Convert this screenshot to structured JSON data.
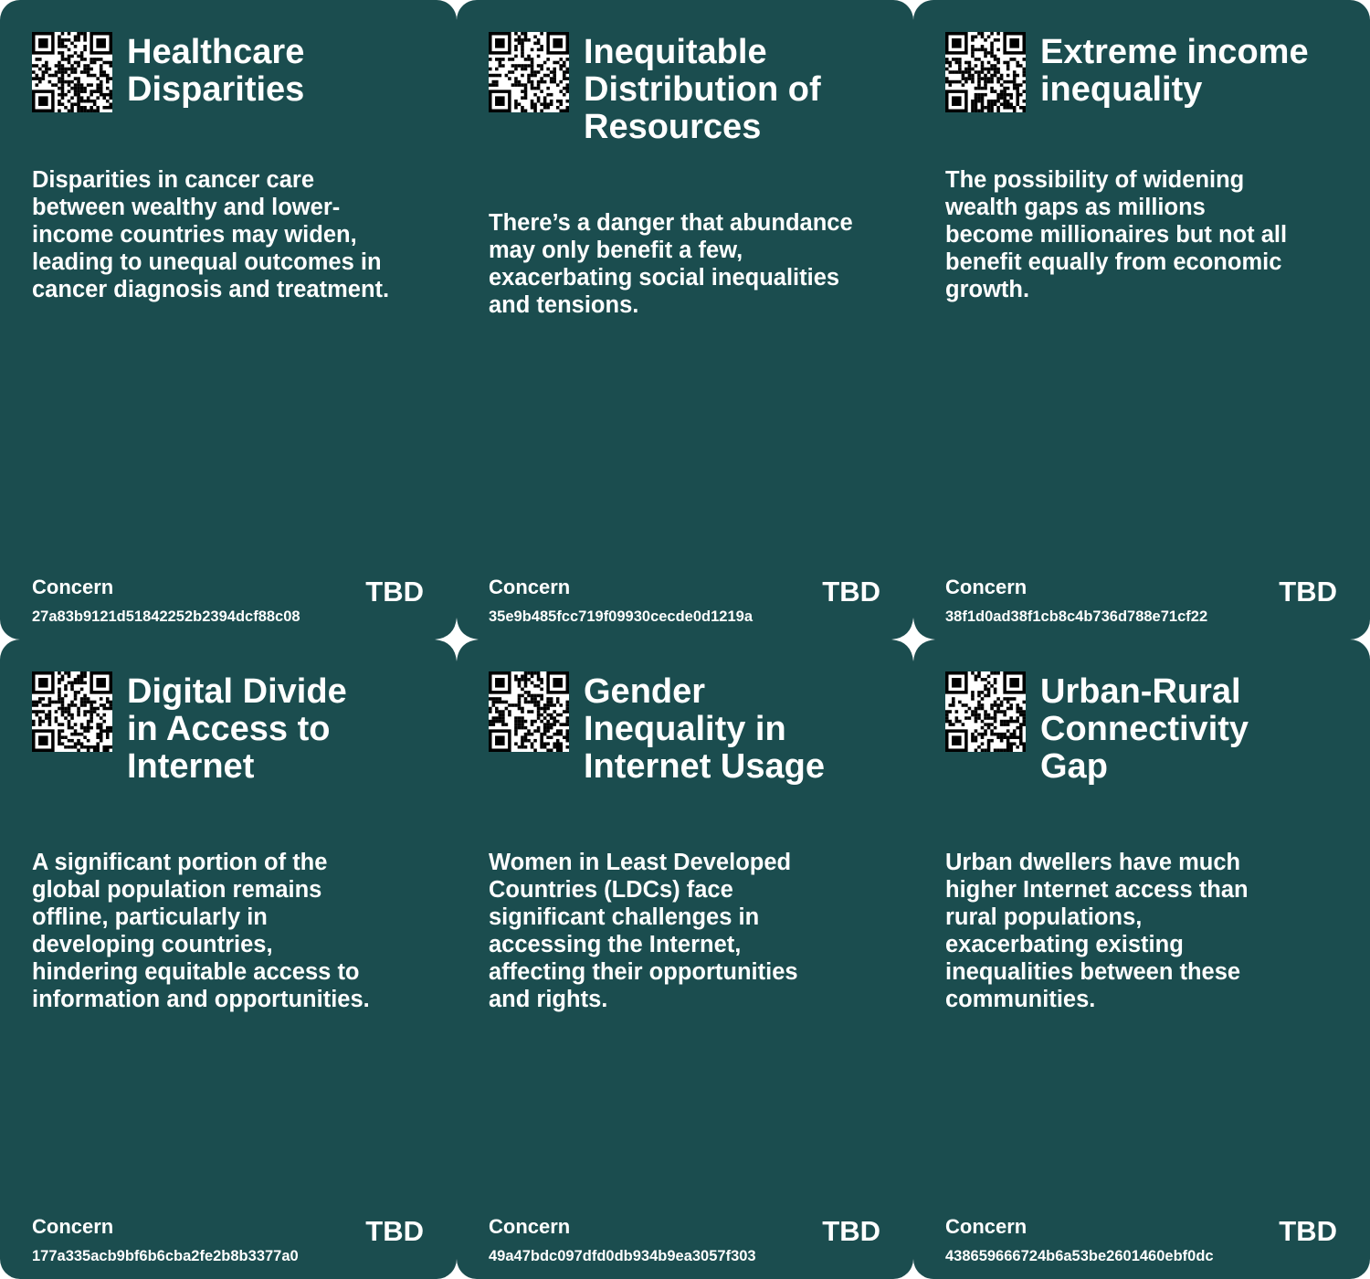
{
  "colors": {
    "card_background": "#1b4d4f",
    "text": "#ffffff",
    "gutter": "#ffffff"
  },
  "cards": [
    {
      "title": "Healthcare Disparities",
      "description": "Disparities in cancer care between wealthy and lower-income countries may widen, leading to unequal outcomes in cancer diagnosis and treatment.",
      "type_label": "Concern",
      "id": "27a83b9121d51842252b2394dcf88c08",
      "status": "TBD",
      "icon": "qr-code-icon"
    },
    {
      "title": "Inequitable Distribution of Resources",
      "description": "There’s a danger that abundance may only benefit a few, exacerbating social inequalities and tensions.",
      "type_label": "Concern",
      "id": "35e9b485fcc719f09930cecde0d1219a",
      "status": "TBD",
      "icon": "qr-code-icon"
    },
    {
      "title": "Extreme income inequality",
      "description": "The possibility of widening wealth gaps as millions become millionaires but not all benefit equally from economic growth.",
      "type_label": "Concern",
      "id": "38f1d0ad38f1cb8c4b736d788e71cf22",
      "status": "TBD",
      "icon": "qr-code-icon"
    },
    {
      "title": "Digital Divide in Access to Internet",
      "description": "A significant portion of the global population remains offline, particularly in developing countries, hindering equitable access to information and opportunities.",
      "type_label": "Concern",
      "id": "177a335acb9bf6b6cba2fe2b8b3377a0",
      "status": "TBD",
      "icon": "qr-code-icon"
    },
    {
      "title": "Gender Inequality in Internet Usage",
      "description": "Women in Least Developed Countries (LDCs) face significant challenges in accessing the Internet, affecting their opportunities and rights.",
      "type_label": "Concern",
      "id": "49a47bdc097dfd0db934b9ea3057f303",
      "status": "TBD",
      "icon": "qr-code-icon"
    },
    {
      "title": "Urban-Rural Connectivity Gap",
      "description": "Urban dwellers have much higher Internet access than rural populations, exacerbating existing inequalities between these communities.",
      "type_label": "Concern",
      "id": "438659666724b6a53be2601460ebf0dc",
      "status": "TBD",
      "icon": "qr-code-icon"
    }
  ]
}
